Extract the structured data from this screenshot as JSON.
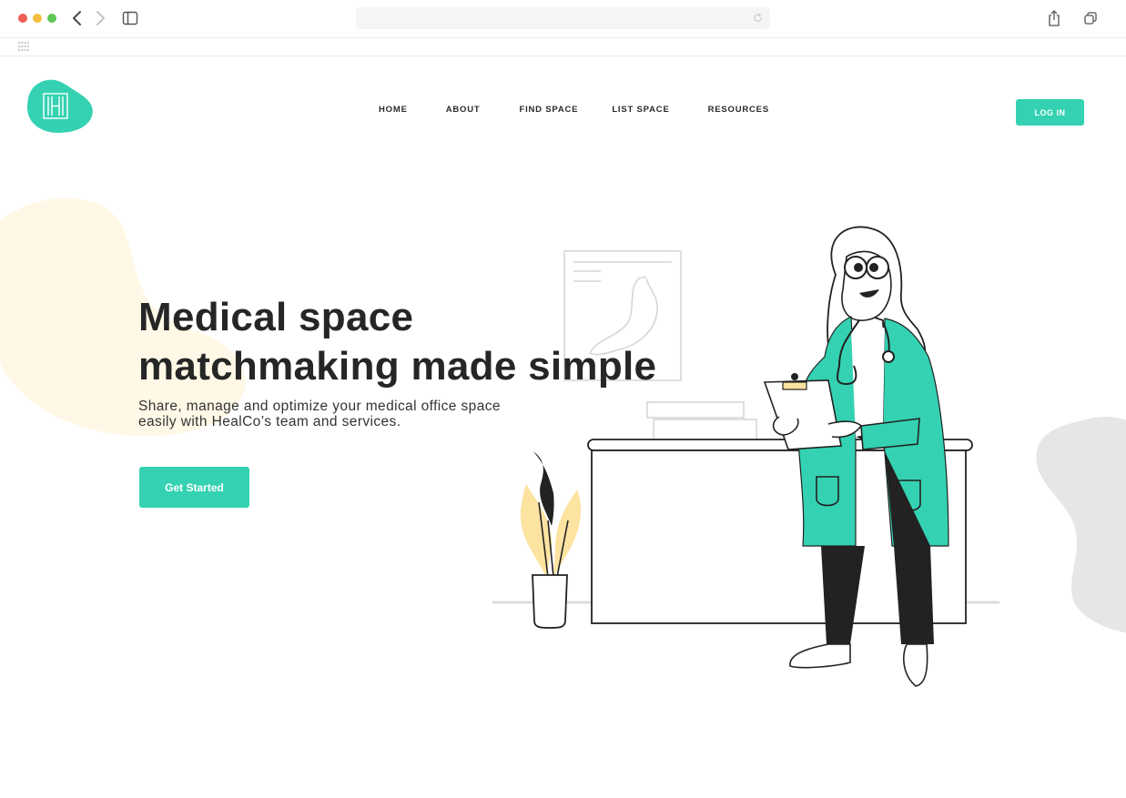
{
  "colors": {
    "accent": "#34d2b2",
    "text_dark": "#262626",
    "blob_yellow": "#fff8e6",
    "blob_gray": "#e6e6e6",
    "plant_yellow": "#fde3a0"
  },
  "browser": {
    "icons": [
      "back-arrow-icon",
      "forward-arrow-icon",
      "sidebar-icon",
      "reload-icon",
      "share-icon",
      "tabs-icon",
      "grid-icon"
    ]
  },
  "header": {
    "logo_letter": "H",
    "nav": [
      {
        "label": "HOME"
      },
      {
        "label": "ABOUT"
      },
      {
        "label": "FIND SPACE"
      },
      {
        "label": "LIST SPACE"
      },
      {
        "label": "RESOURCES"
      }
    ],
    "login_label": "LOG IN"
  },
  "hero": {
    "title": "Medical space\nmatchmaking made simple",
    "subtitle": "Share, manage and optimize your medical office space easily with HealCo’s team and services.",
    "cta_label": "Get Started"
  }
}
